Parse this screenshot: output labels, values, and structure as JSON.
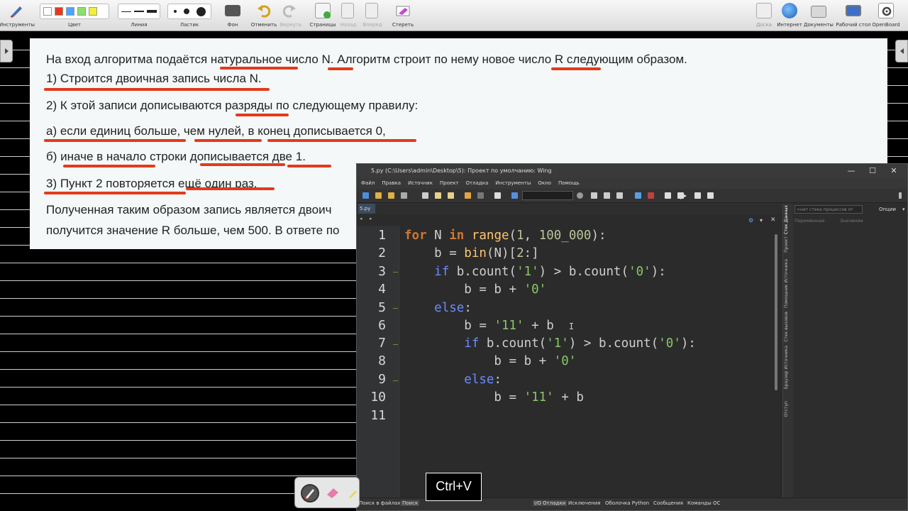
{
  "toolbar": {
    "left": [
      {
        "icon": "tools-icon",
        "label": "Инструменты"
      },
      {
        "icon": "color-icon",
        "label": "Цвет"
      },
      {
        "icon": "line-icon",
        "label": "Линия"
      },
      {
        "icon": "eraser-size-icon",
        "label": "Ластик"
      },
      {
        "icon": "background-icon",
        "label": "Фон"
      },
      {
        "icon": "undo-icon",
        "label": "Отменить"
      },
      {
        "icon": "redo-icon",
        "label": "Вернуть"
      },
      {
        "icon": "pages-icon",
        "label": "Страницы"
      },
      {
        "icon": "back-icon",
        "label": "Назад"
      },
      {
        "icon": "forward-icon",
        "label": "Вперед"
      },
      {
        "icon": "erase-icon",
        "label": "Стереть"
      }
    ],
    "right": [
      {
        "icon": "board-icon",
        "label": "Доска"
      },
      {
        "icon": "internet-icon",
        "label": "Интернет"
      },
      {
        "icon": "documents-icon",
        "label": "Документы"
      },
      {
        "icon": "desktop-icon",
        "label": "Рабочий стол"
      },
      {
        "icon": "openboard-icon",
        "label": "OpenBoard"
      }
    ],
    "colors": [
      "#ffffff",
      "#e33a1a",
      "#4aa3ff",
      "#8be06a",
      "#f2ef3a"
    ]
  },
  "document": {
    "lines": [
      "На вход алгоритма подаётся натуральное число N. Алгоритм строит по нему новое число R следующим образом.",
      "1) Строится двоичная запись числа N.",
      "2) К этой записи дописываются разряды по следующему правилу:",
      "а) если единиц больше, чем нулей, в конец дописывается 0,",
      "б) иначе в начало строки дописывается две 1.",
      "3) Пункт 2 повторяется ещё один раз.",
      "Полученная таким образом запись является двоич",
      "получится значение R больше, чем 500. В ответе по"
    ],
    "annotation_color": "#e23b1b"
  },
  "ide": {
    "title": "5.py (C:\\Users\\admin\\Desktop\\5): Проект по умолчанию: Wing",
    "menu": [
      "Файл",
      "Правка",
      "Источник",
      "Проект",
      "Отладка",
      "Инструменты",
      "Окно",
      "Помощь"
    ],
    "tab": "5.py",
    "line_numbers": [
      "1",
      "2",
      "3",
      "4",
      "5",
      "6",
      "7",
      "8",
      "9",
      "10",
      "11"
    ],
    "right_panel": {
      "dropdown": "<нет стека процессов от",
      "options": "Опции",
      "col1": "Переменная",
      "col2": "Значение",
      "side_tabs": [
        "Стек Данных",
        "Проект",
        "Помощник Источника",
        "Стек вызовов",
        "Браузер Источника",
        "Отступ"
      ]
    },
    "status_tabs": [
      "Поиск в файлах",
      "Поиск",
      "I/O Отладки",
      "Исключения",
      "Оболочка Python",
      "Сообщения",
      "Команды ОС"
    ]
  },
  "overlay": {
    "keys": "Ctrl+V"
  }
}
